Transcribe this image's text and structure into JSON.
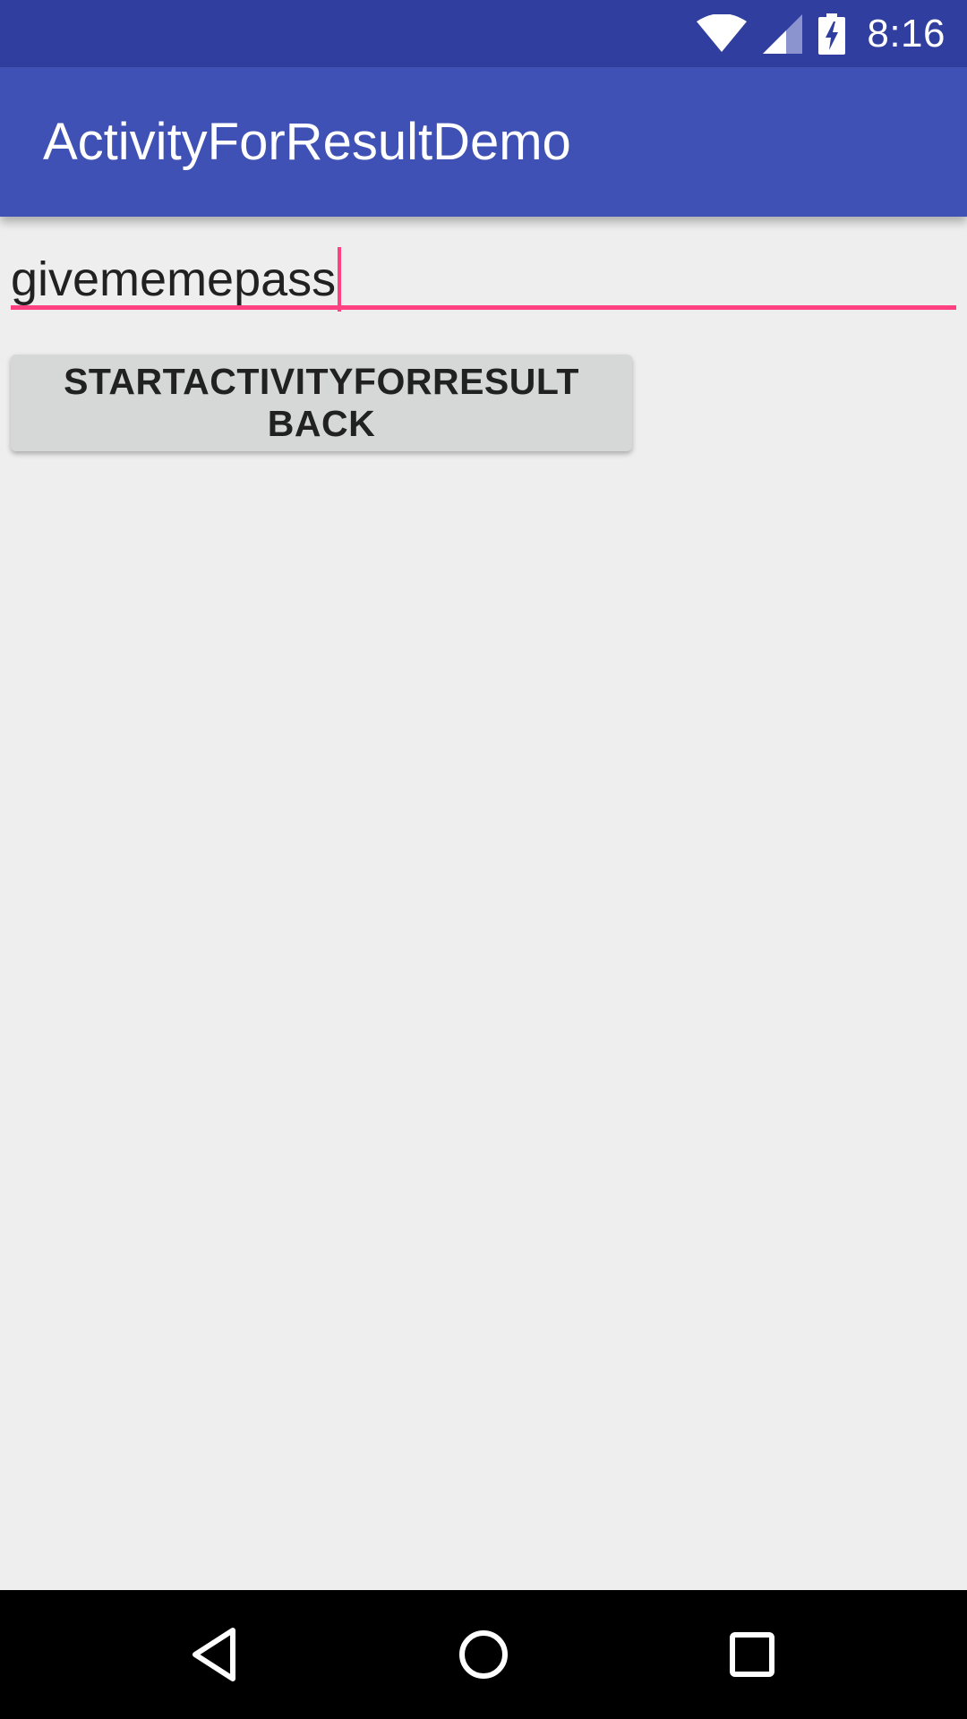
{
  "status_bar": {
    "time": "8:16",
    "icons": [
      "wifi-icon",
      "signal-icon",
      "battery-charging-icon"
    ],
    "background_color": "#303f9f"
  },
  "app_bar": {
    "title": "ActivityForResultDemo",
    "background_color": "#3f51b5"
  },
  "main": {
    "text_field": {
      "value": "givememepass",
      "accent_color": "#ff4081"
    },
    "button": {
      "label": "STARTACTIVITYFORRESULT BACK",
      "background_color": "#d6d7d7"
    }
  },
  "nav_bar": {
    "buttons": [
      "back-icon",
      "home-icon",
      "recents-icon"
    ],
    "background_color": "#000000"
  }
}
